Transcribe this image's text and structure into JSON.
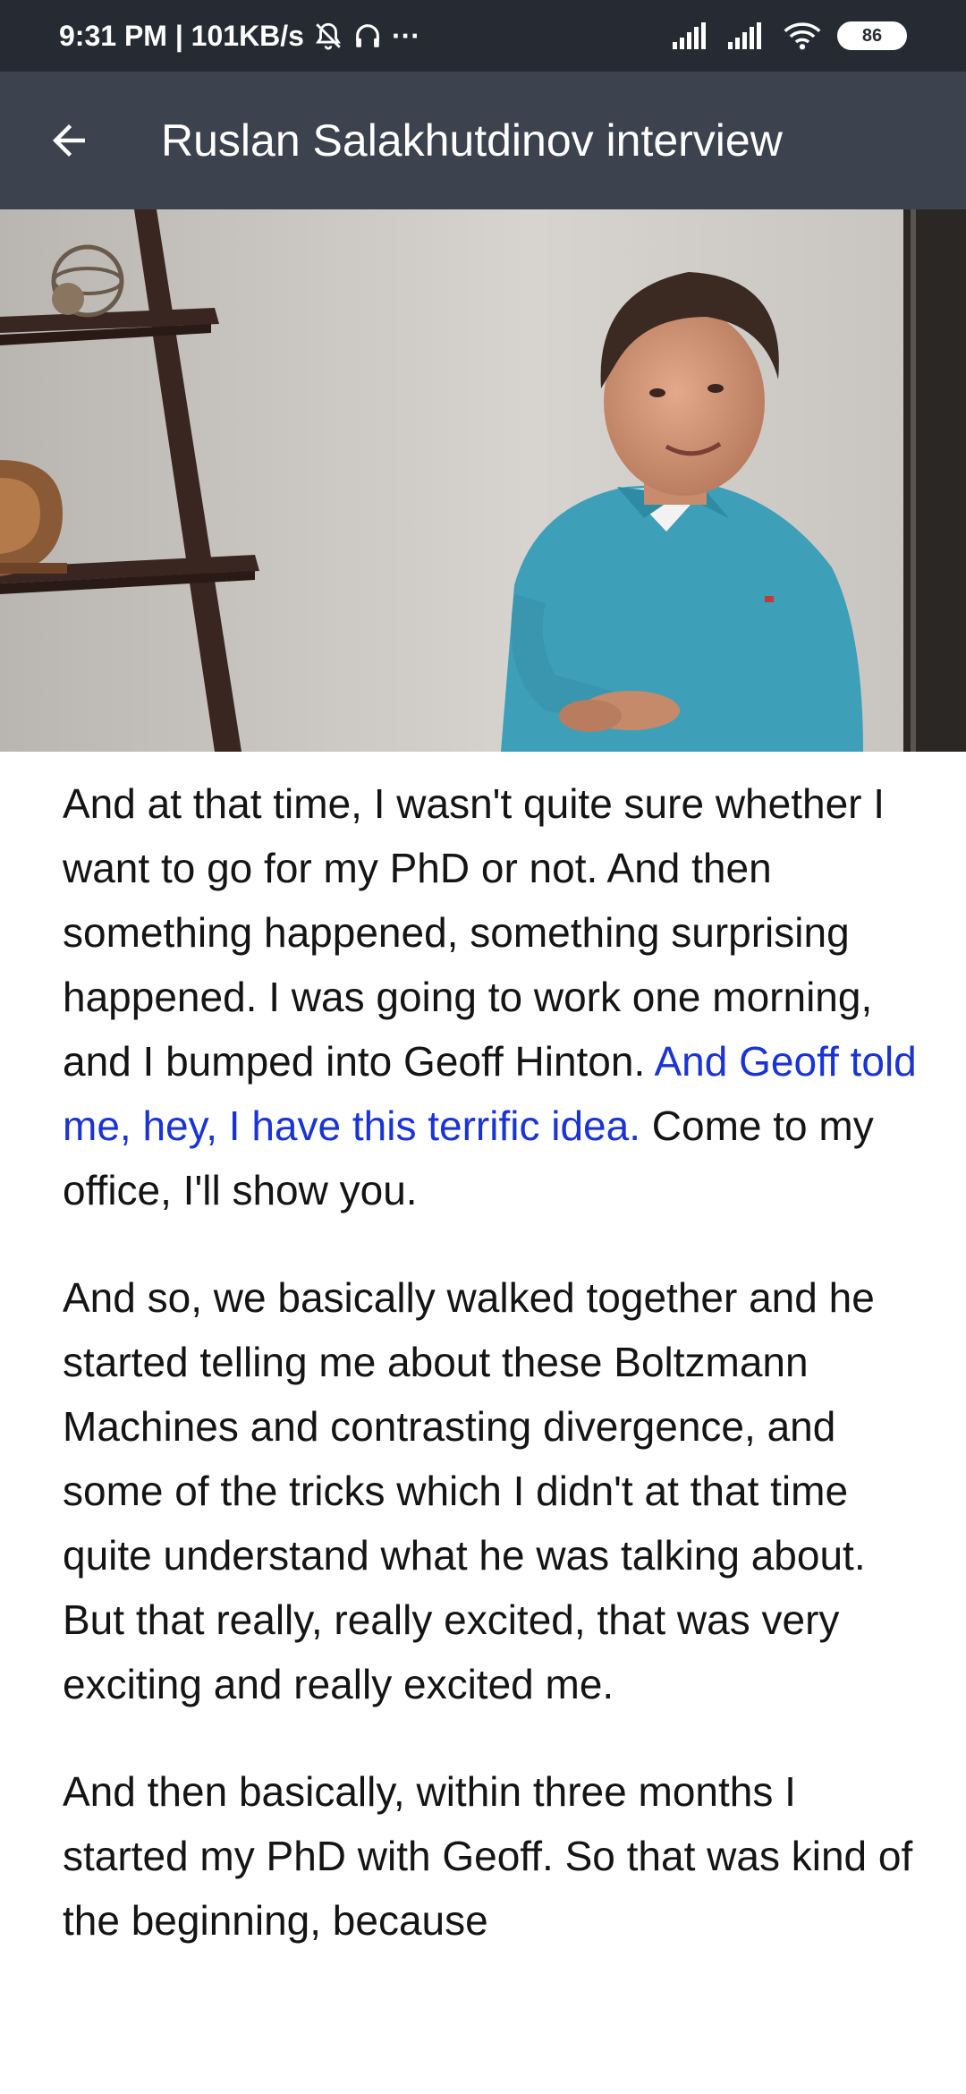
{
  "status_bar": {
    "time_speed": "9:31 PM | 101KB/s",
    "more": "···",
    "battery": "86",
    "icons": [
      "alarm-off-icon",
      "headphones-icon",
      "signal-icon",
      "signal-icon",
      "wifi-icon",
      "battery-icon"
    ]
  },
  "app_bar": {
    "back_icon": "arrow-back-icon",
    "title": "Ruslan Salakhutdinov interview"
  },
  "video": {
    "description_icon": "video-frame"
  },
  "transcript": {
    "paragraphs": [
      {
        "before": "And at that time, I wasn't quite sure whether I want to go for my PhD or not. And then something happened, something surprising happened. I was going to work one morning, and I bumped into Geoff Hinton. ",
        "highlight": "And Geoff told me, hey, I have this terrific idea.",
        "after": " Come to my office, I'll show you."
      },
      {
        "text": "And so, we basically walked together and he started telling me about these Boltzmann Machines and contrasting divergence, and some of the tricks which I didn't at that time quite understand what he was talking about. But that really, really excited, that was very exciting and really excited me."
      },
      {
        "text": "And then basically, within three months I started my PhD with Geoff. So that was kind of the beginning, because"
      }
    ],
    "highlight_color": "#1a33d6"
  }
}
